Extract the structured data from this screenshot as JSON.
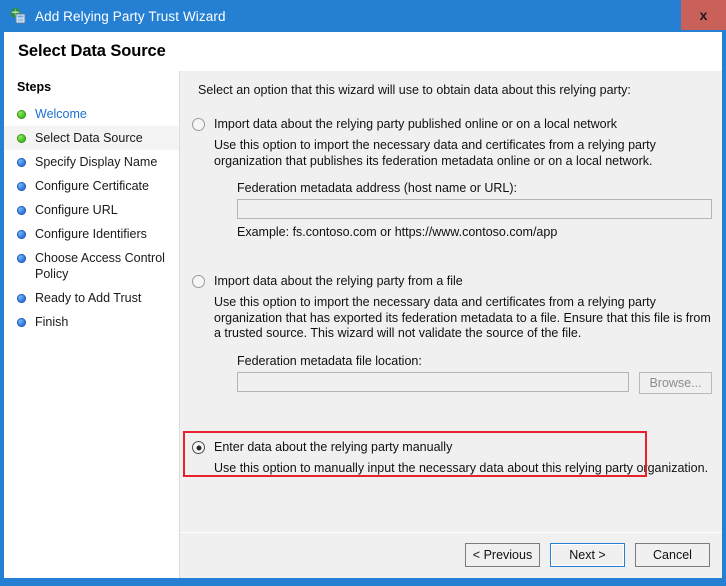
{
  "window": {
    "title": "Add Relying Party Trust Wizard",
    "icon": "relying-party-trust-icon",
    "close_label": "x"
  },
  "header": {
    "title": "Select Data Source"
  },
  "sidebar": {
    "heading": "Steps",
    "items": [
      {
        "label": "Welcome",
        "state": "done",
        "style": "link"
      },
      {
        "label": "Select Data Source",
        "state": "done",
        "style": "current"
      },
      {
        "label": "Specify Display Name",
        "state": "pending",
        "style": "normal"
      },
      {
        "label": "Configure Certificate",
        "state": "pending",
        "style": "normal"
      },
      {
        "label": "Configure URL",
        "state": "pending",
        "style": "normal"
      },
      {
        "label": "Configure Identifiers",
        "state": "pending",
        "style": "normal"
      },
      {
        "label": "Choose Access Control Policy",
        "state": "pending",
        "style": "normal"
      },
      {
        "label": "Ready to Add Trust",
        "state": "pending",
        "style": "normal"
      },
      {
        "label": "Finish",
        "state": "pending",
        "style": "normal"
      }
    ]
  },
  "content": {
    "intro": "Select an option that this wizard will use to obtain data about this relying party:",
    "option_online": {
      "label": "Import data about the relying party published online or on a local network",
      "description": "Use this option to import the necessary data and certificates from a relying party organization that publishes its federation metadata online or on a local network.",
      "field_label": "Federation metadata address (host name or URL):",
      "field_value": "",
      "example": "Example: fs.contoso.com or https://www.contoso.com/app",
      "selected": false
    },
    "option_file": {
      "label": "Import data about the relying party from a file",
      "description": "Use this option to import the necessary data and certificates from a relying party organization that has exported its federation metadata to a file. Ensure that this file is from a trusted source.  This wizard will not validate the source of the file.",
      "field_label": "Federation metadata file location:",
      "field_value": "",
      "browse_label": "Browse...",
      "selected": false
    },
    "option_manual": {
      "label": "Enter data about the relying party manually",
      "description": "Use this option to manually input the necessary data about this relying party organization.",
      "selected": true
    }
  },
  "footer": {
    "previous_label": "< Previous",
    "next_label": "Next >",
    "cancel_label": "Cancel"
  },
  "colors": {
    "frame_blue": "#2580d4",
    "close_red": "#c9605a",
    "highlight_red": "#e8212b",
    "panel_gray": "#f0f0f0",
    "link_blue": "#1d6fd4",
    "bullet_done_green": "#45c226",
    "bullet_pending_blue": "#2f7de0"
  }
}
